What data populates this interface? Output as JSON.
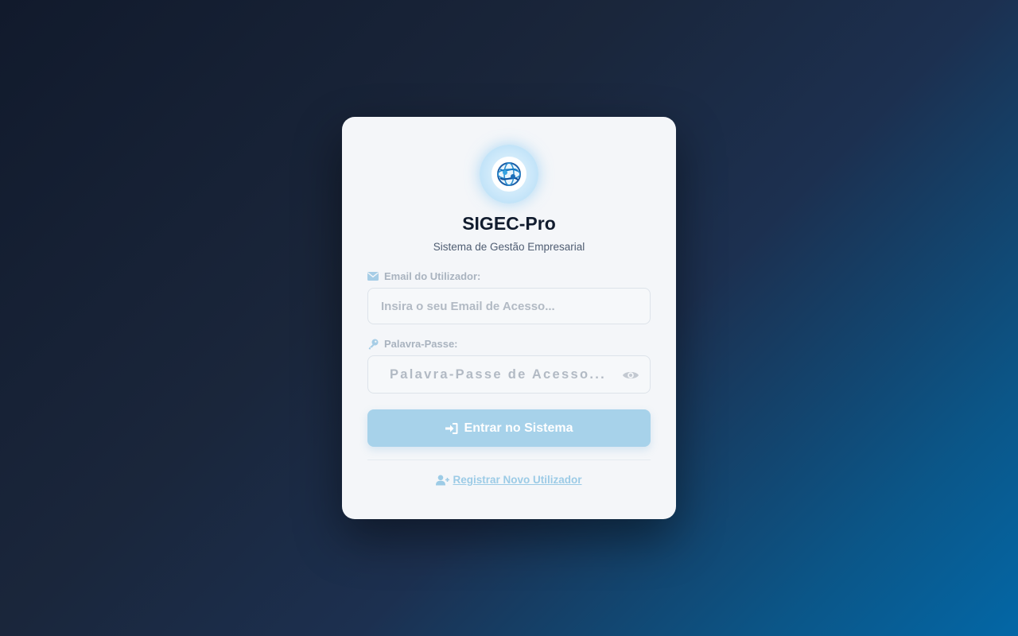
{
  "app": {
    "title": "SIGEC-Pro",
    "subtitle": "Sistema de Gestão Empresarial",
    "logo_icon": "globe-logo-icon"
  },
  "form": {
    "email": {
      "label": "Email do Utilizador:",
      "icon": "envelope-icon",
      "placeholder": "Insira o seu Email de Acesso...",
      "value": ""
    },
    "password": {
      "label": "Palavra-Passe:",
      "icon": "key-icon",
      "placeholder": "Palavra-Passe de Acesso...",
      "value": "",
      "toggle_icon": "eye-icon"
    },
    "submit": {
      "label": "Entrar no Sistema",
      "icon": "sign-in-icon"
    },
    "register": {
      "label": "Registrar Novo Utilizador",
      "icon": "user-plus-icon"
    }
  },
  "colors": {
    "primary_button": "#a7d2ea",
    "title": "#111c2e",
    "label": "#a9b3bf",
    "link": "#9ccbe6"
  }
}
